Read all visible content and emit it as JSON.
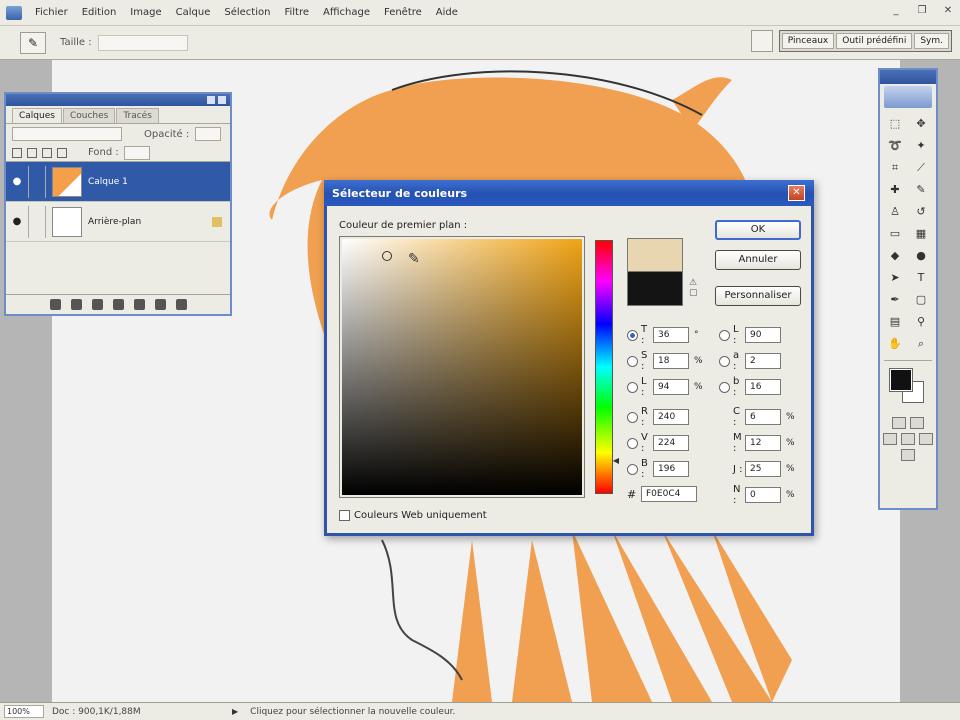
{
  "menubar": {
    "items": [
      "Fichier",
      "Edition",
      "Image",
      "Calque",
      "Sélection",
      "Filtre",
      "Affichage",
      "Fenêtre",
      "Aide"
    ]
  },
  "options": {
    "mode_label": "Taille :",
    "panel_tabs": [
      "Pinceaux",
      "Outil prédéfini",
      "Sym."
    ]
  },
  "layers_panel": {
    "tabs": [
      "Calques",
      "Couches",
      "Tracés"
    ],
    "opacity_label": "Opacité :",
    "fill_label": "Fond :",
    "layers": [
      {
        "name": "Calque 1",
        "selected": true
      },
      {
        "name": "Arrière-plan",
        "selected": false
      }
    ]
  },
  "color_picker": {
    "title": "Sélecteur de couleurs",
    "subtitle": "Couleur de premier plan :",
    "buttons": {
      "ok": "OK",
      "cancel": "Annuler",
      "libraries": "Personnaliser"
    },
    "hsb": [
      {
        "label": "T :",
        "value": "36",
        "unit": "°",
        "selected": true
      },
      {
        "label": "S :",
        "value": "18",
        "unit": "%",
        "selected": false
      },
      {
        "label": "L :",
        "value": "94",
        "unit": "%",
        "selected": false
      }
    ],
    "rgb": [
      {
        "label": "R :",
        "value": "240",
        "selected": false
      },
      {
        "label": "V :",
        "value": "224",
        "selected": false
      },
      {
        "label": "B :",
        "value": "196",
        "selected": false
      }
    ],
    "lab": [
      {
        "label": "L :",
        "value": "90",
        "selected": false
      },
      {
        "label": "a :",
        "value": "2",
        "selected": false
      },
      {
        "label": "b :",
        "value": "16",
        "selected": false
      }
    ],
    "cmyk": [
      {
        "label": "C :",
        "value": "6",
        "unit": "%"
      },
      {
        "label": "M :",
        "value": "12",
        "unit": "%"
      },
      {
        "label": "J :",
        "value": "25",
        "unit": "%"
      },
      {
        "label": "N :",
        "value": "0",
        "unit": "%"
      }
    ],
    "hex_label": "#",
    "hex_value": "F0E0C4",
    "web_only_label": "Couleurs Web uniquement",
    "new_color": "#e8d6b0",
    "current_color": "#141414"
  },
  "statusbar": {
    "zoom": "100%",
    "doc": "Doc : 900,1K/1,88M",
    "hint": "Cliquez pour sélectionner la nouvelle couleur."
  },
  "colors": {
    "hair": "#f0a050",
    "titlebar": "#2d54a6"
  }
}
